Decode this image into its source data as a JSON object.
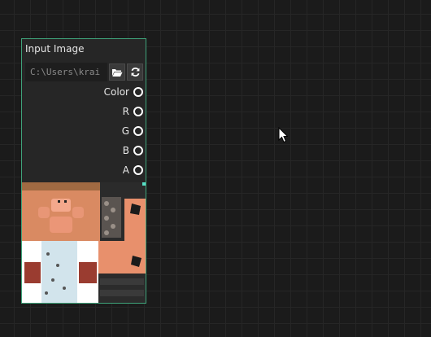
{
  "node": {
    "title": "Input Image",
    "path_value": "C:\\Users\\krai",
    "outputs": [
      "Color",
      "R",
      "G",
      "B",
      "A"
    ]
  },
  "colors": {
    "node_border": "#3fa37a",
    "canvas": "#1b1b1b",
    "node_body": "#262626",
    "handle": "#58e0c8"
  }
}
